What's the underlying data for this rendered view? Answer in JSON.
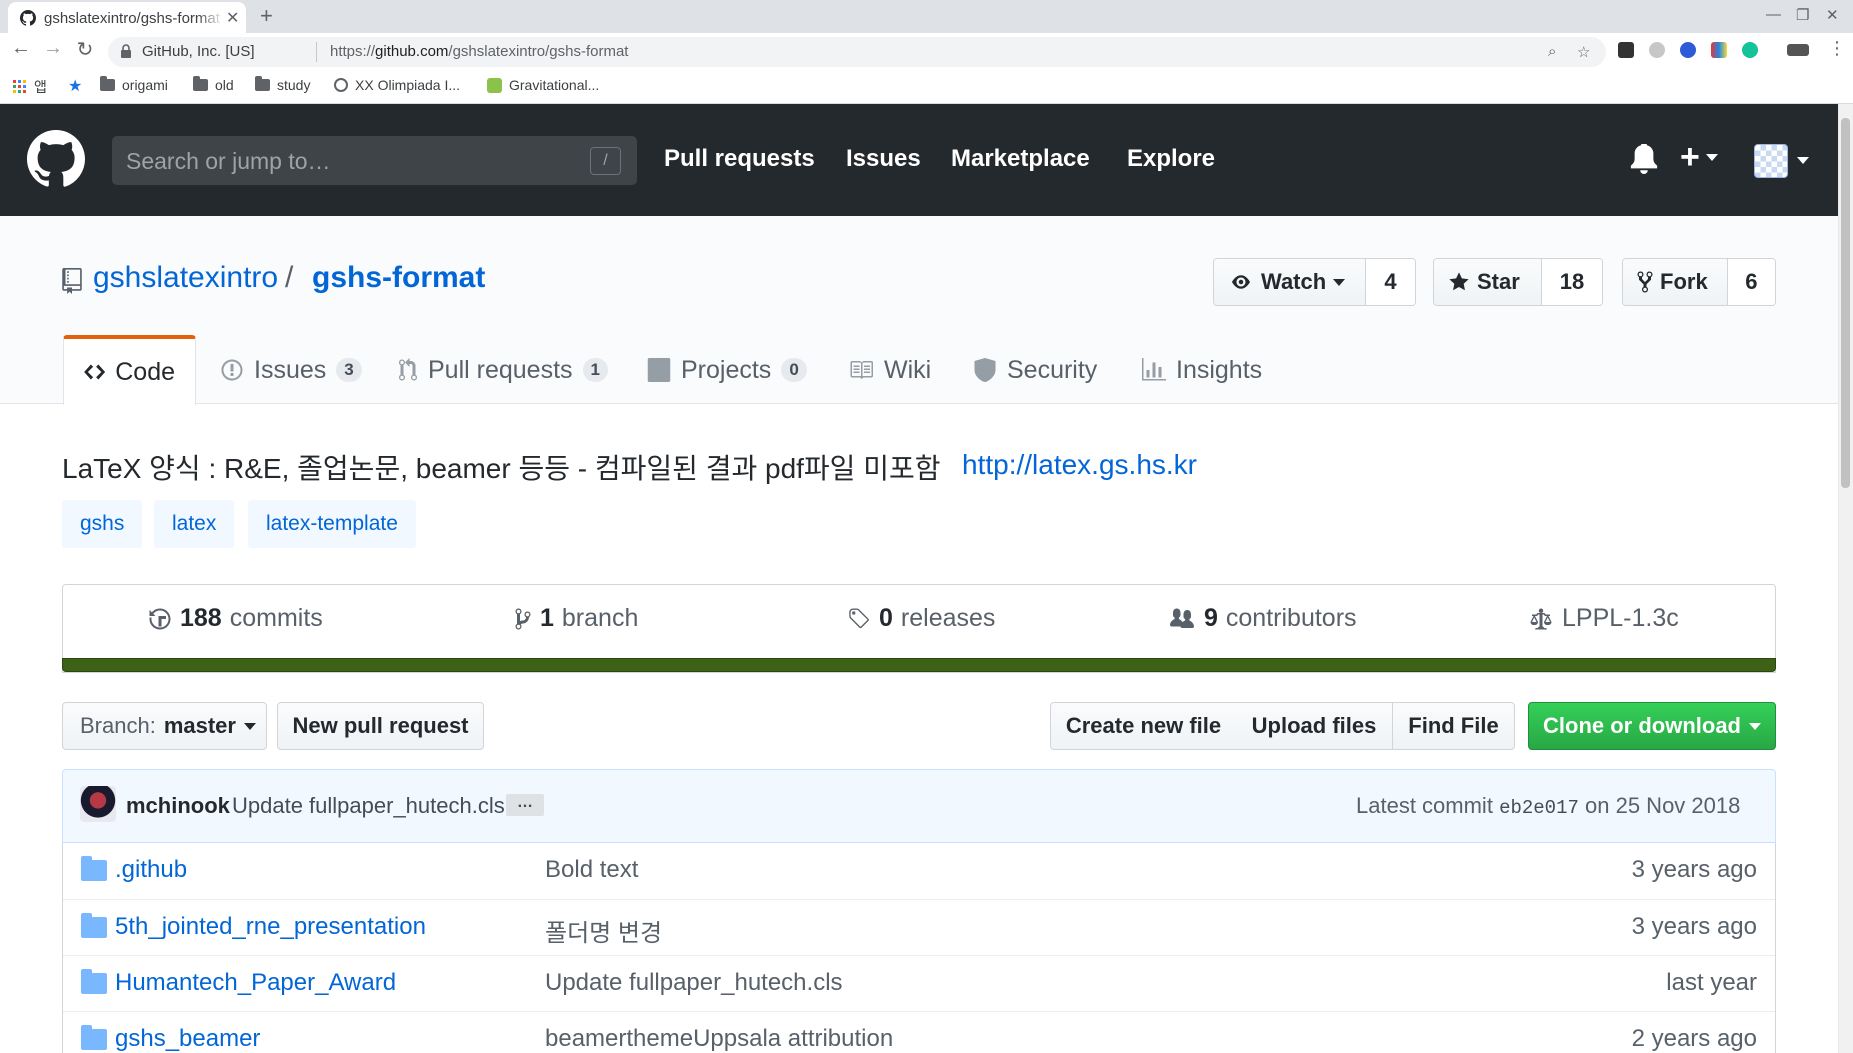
{
  "browser": {
    "tab_title": "gshslatexintro/gshs-format",
    "site_identity": "GitHub, Inc. [US]",
    "url_prefix": "https://",
    "url_domain": "github.com",
    "url_path": "/gshslatexintro/gshs-format",
    "bookmarks": {
      "apps": "앱",
      "items": [
        "origami",
        "old",
        "study",
        "XX Olimpiada I...",
        "Gravitational..."
      ]
    }
  },
  "github_header": {
    "search_placeholder": "Search or jump to…",
    "search_shortcut": "/",
    "nav": [
      "Pull requests",
      "Issues",
      "Marketplace",
      "Explore"
    ]
  },
  "repo": {
    "owner": "gshslatexintro",
    "separator": "/",
    "name": "gshs-format",
    "watch": {
      "label": "Watch",
      "count": "4"
    },
    "star": {
      "label": "Star",
      "count": "18"
    },
    "fork": {
      "label": "Fork",
      "count": "6"
    }
  },
  "tabs": {
    "code": {
      "label": "Code"
    },
    "issues": {
      "label": "Issues",
      "count": "3"
    },
    "pulls": {
      "label": "Pull requests",
      "count": "1"
    },
    "projects": {
      "label": "Projects",
      "count": "0"
    },
    "wiki": {
      "label": "Wiki"
    },
    "security": {
      "label": "Security"
    },
    "insights": {
      "label": "Insights"
    }
  },
  "description": {
    "text": "LaTeX 양식 : R&E, 졸업논문, beamer 등등 - 컴파일된 결과 pdf파일 미포함",
    "homepage": "http://latex.gs.hs.kr",
    "topics": [
      "gshs",
      "latex",
      "latex-template"
    ]
  },
  "summary": {
    "commits": {
      "count": "188",
      "label": "commits"
    },
    "branch": {
      "count": "1",
      "label": "branch"
    },
    "releases": {
      "count": "0",
      "label": "releases"
    },
    "contributors": {
      "count": "9",
      "label": "contributors"
    },
    "license": "LPPL-1.3c",
    "language_color": "#3d6117"
  },
  "file_nav": {
    "branch_prefix": "Branch:",
    "branch_name": "master",
    "new_pr": "New pull request",
    "create_file": "Create new file",
    "upload_files": "Upload files",
    "find_file": "Find File",
    "clone": "Clone or download"
  },
  "latest_commit": {
    "author": "mchinook",
    "message": "Update fullpaper_hutech.cls",
    "ellipsis": "…",
    "prefix": "Latest commit",
    "sha": "eb2e017",
    "date": "on 25 Nov 2018"
  },
  "files": [
    {
      "name": ".github",
      "message": "Bold text",
      "age": "3 years ago"
    },
    {
      "name": "5th_jointed_rne_presentation",
      "message": "폴더명 변경",
      "age": "3 years ago"
    },
    {
      "name": "Humantech_Paper_Award",
      "message": "Update fullpaper_hutech.cls",
      "age": "last year"
    },
    {
      "name": "gshs_beamer",
      "message": "beamerthemeUppsala attribution",
      "age": "2 years ago"
    }
  ]
}
